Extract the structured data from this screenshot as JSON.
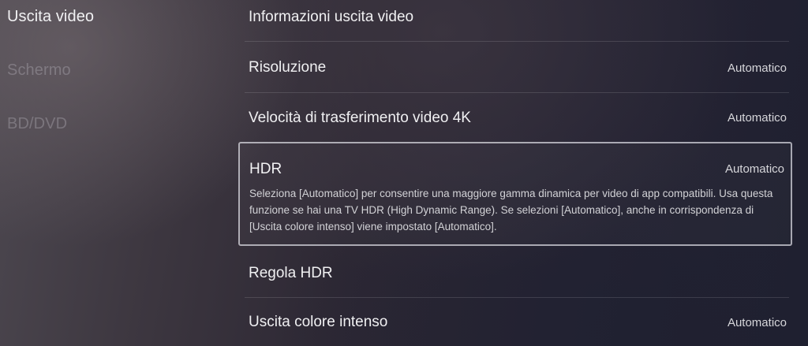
{
  "sidebar": {
    "items": [
      {
        "label": "Uscita video"
      },
      {
        "label": "Schermo"
      },
      {
        "label": "BD/DVD"
      }
    ]
  },
  "settings": {
    "info": {
      "label": "Informazioni uscita video"
    },
    "resolution": {
      "label": "Risoluzione",
      "value": "Automatico"
    },
    "transfer_4k": {
      "label": "Velocità di trasferimento video 4K",
      "value": "Automatico"
    },
    "hdr": {
      "label": "HDR",
      "value": "Automatico",
      "description": "Seleziona [Automatico] per consentire una maggiore gamma dinamica per video di app compatibili. Usa questa funzione se hai una TV HDR (High Dynamic Range). Se selezioni [Automatico], anche in corrispondenza di [Uscita colore intenso] viene impostato [Automatico]."
    },
    "adjust_hdr": {
      "label": "Regola HDR"
    },
    "deep_color": {
      "label": "Uscita colore intenso",
      "value": "Automatico"
    }
  },
  "colors": {
    "focus_border": "#e1e1e8",
    "text": "#f0f0f2",
    "dim_text": "#5c5862"
  }
}
